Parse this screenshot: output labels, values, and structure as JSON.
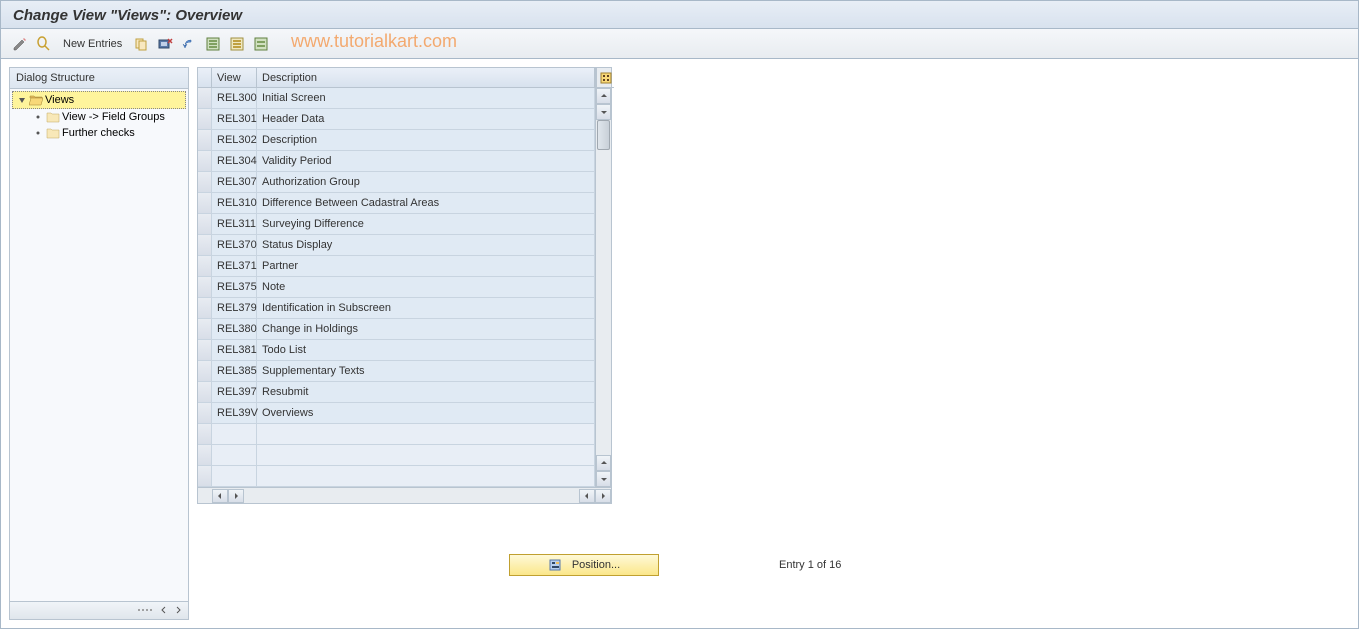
{
  "title": "Change View \"Views\": Overview",
  "toolbar": {
    "new_entries": "New Entries"
  },
  "watermark": "www.tutorialkart.com",
  "sidebar": {
    "header": "Dialog Structure",
    "nodes": [
      {
        "label": "Views",
        "selected": true,
        "type": "open-folder"
      },
      {
        "label": "View -> Field Groups",
        "child": true,
        "type": "folder"
      },
      {
        "label": "Further checks",
        "child": true,
        "type": "folder"
      }
    ]
  },
  "table": {
    "columns": {
      "view": "View",
      "description": "Description"
    },
    "rows": [
      {
        "view": "REL300",
        "desc": "Initial Screen"
      },
      {
        "view": "REL301",
        "desc": "Header Data"
      },
      {
        "view": "REL302",
        "desc": "Description"
      },
      {
        "view": "REL304",
        "desc": "Validity Period"
      },
      {
        "view": "REL307",
        "desc": "Authorization Group"
      },
      {
        "view": "REL310",
        "desc": "Difference Between Cadastral Areas"
      },
      {
        "view": "REL311",
        "desc": "Surveying Difference"
      },
      {
        "view": "REL370",
        "desc": "Status Display"
      },
      {
        "view": "REL371",
        "desc": "Partner"
      },
      {
        "view": "REL375",
        "desc": "Note"
      },
      {
        "view": "REL379",
        "desc": "Identification in Subscreen"
      },
      {
        "view": "REL380",
        "desc": "Change in Holdings"
      },
      {
        "view": "REL381",
        "desc": "Todo List"
      },
      {
        "view": "REL385",
        "desc": "Supplementary Texts"
      },
      {
        "view": "REL397",
        "desc": "Resubmit"
      },
      {
        "view": "REL39V",
        "desc": "Overviews"
      }
    ],
    "empty_rows": 3
  },
  "footer": {
    "position_label": "Position...",
    "entry_text": "Entry 1 of 16"
  }
}
